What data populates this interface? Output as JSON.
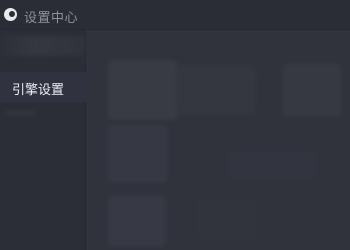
{
  "window": {
    "title": "设置中心"
  },
  "sidebar": {
    "items": [
      {
        "label": "引擎设置",
        "selected": true
      }
    ]
  },
  "colors": {
    "titlebar": "#2a2c36",
    "sidebar": "#2b2d37",
    "main": "#30323c",
    "text_active": "#eeeff2",
    "text_muted": "#8e909a"
  }
}
